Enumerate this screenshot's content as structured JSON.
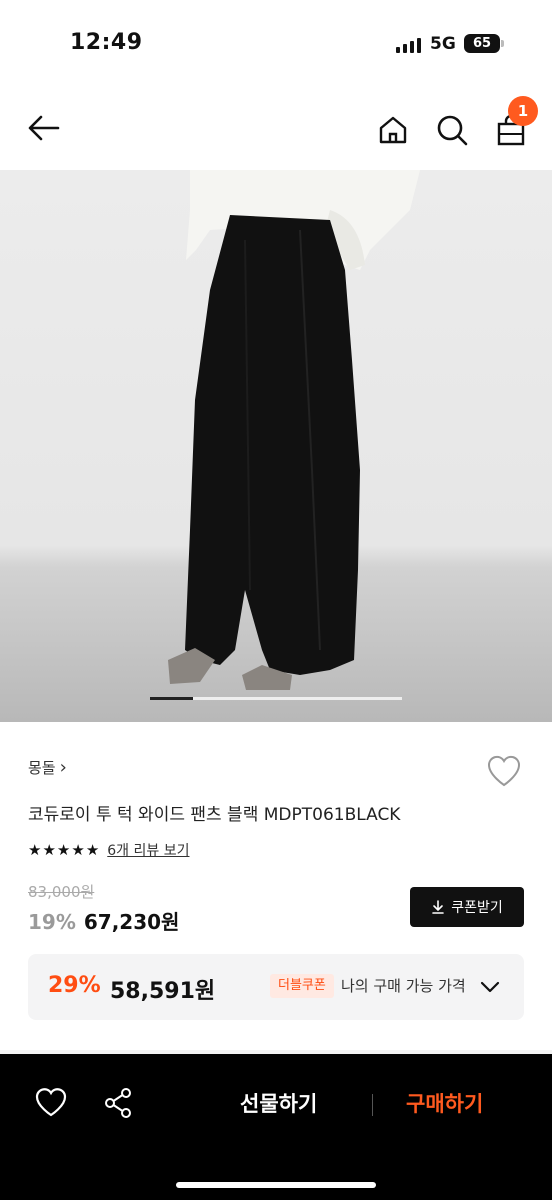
{
  "status_bar": {
    "time": "12:49",
    "network": "5G",
    "battery": "65"
  },
  "nav": {
    "cart_count": "1"
  },
  "carousel": {
    "progress": 0.17
  },
  "product": {
    "brand": "몽돌",
    "brand_chevron": "›",
    "title": "코듀로이 투 턱 와이드 팬츠 블랙 MDPT061BLACK",
    "rating_stars": 5,
    "review_link": "6개 리뷰 보기",
    "original_price": "83,000원",
    "discount_rate": "19%",
    "sale_price": "67,230원",
    "coupon_button": "쿠폰받기"
  },
  "best_price": {
    "rate": "29%",
    "price": "58,591원",
    "tag": "더블쿠폰",
    "label": "나의 구매 가능 가격"
  },
  "bottom_bar": {
    "gift": "선물하기",
    "buy": "구매하기"
  },
  "colors": {
    "accent": "#ff5a1f",
    "sale_red": "#ff4d12"
  },
  "icons": [
    "back-arrow-icon",
    "home-icon",
    "search-icon",
    "shopping-bag-icon",
    "heart-icon",
    "download-icon",
    "chevron-down-icon",
    "share-icon"
  ]
}
